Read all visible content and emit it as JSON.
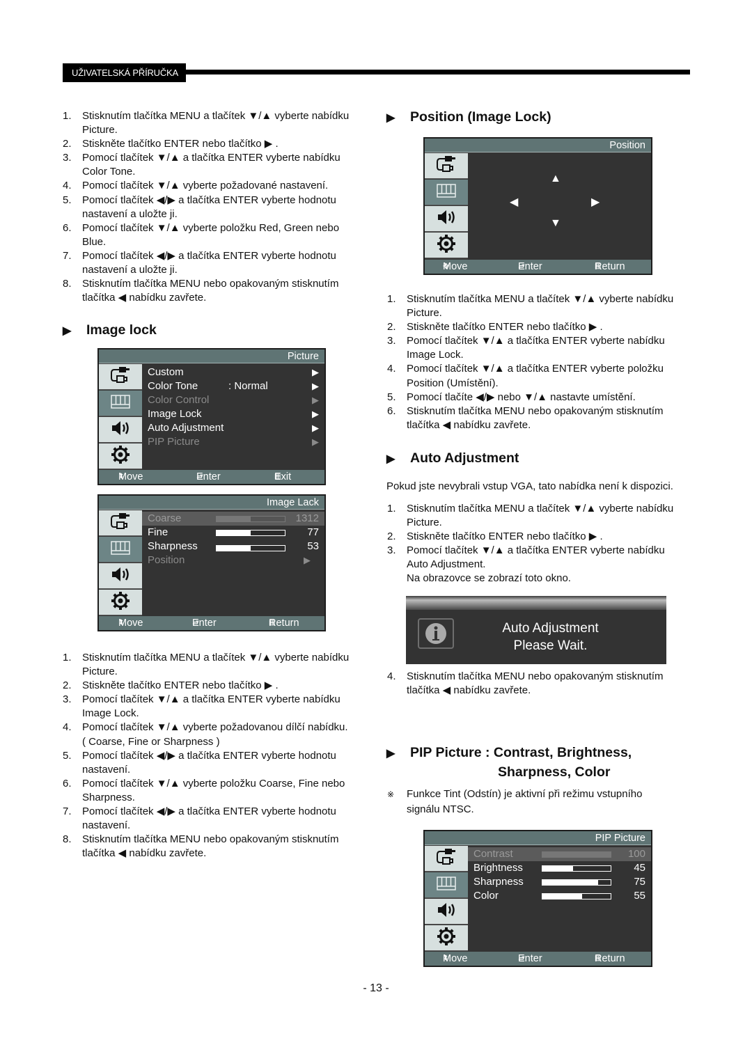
{
  "header": {
    "tag": "UŽIVATELSKÁ PŘÍRUČKA"
  },
  "left": {
    "steps_intro": [
      {
        "n": "1.",
        "lines": [
          "Stisknutím tlačítka MENU a tlačítek ▼/▲ vyberte nabídku",
          "Picture."
        ]
      },
      {
        "n": "2.",
        "lines": [
          "Stiskněte tlačítko ENTER nebo tlačítko ▶ ."
        ]
      },
      {
        "n": "3.",
        "lines": [
          "Pomocí tlačítek ▼/▲ a tlačítka ENTER vyberte nabídku",
          "Color Tone."
        ]
      },
      {
        "n": "4.",
        "lines": [
          "Pomocí tlačítek ▼/▲ vyberte požadované nastavení."
        ]
      },
      {
        "n": "5.",
        "lines": [
          "Pomocí tlačítek ◀/▶ a tlačítka ENTER vyberte hodnotu",
          "nastavení a uložte ji."
        ]
      },
      {
        "n": "6.",
        "lines": [
          "Pomocí tlačítek ▼/▲ vyberte položku Red, Green nebo",
          "Blue."
        ]
      },
      {
        "n": "7.",
        "lines": [
          "Pomocí tlačítek ◀/▶ a tlačítka ENTER vyberte hodnotu",
          "nastavení a uložte ji."
        ]
      },
      {
        "n": "8.",
        "lines": [
          "Stisknutím tlačítka MENU nebo opakovaným stisknutím",
          "tlačítka ◀ nabídku zavřete."
        ]
      }
    ],
    "image_lock_title": "Image lock",
    "picture_menu": {
      "title": "Picture",
      "items": [
        {
          "label": "Custom",
          "value": "",
          "state": "normal"
        },
        {
          "label": "Color Tone",
          "value": ": Normal",
          "state": "normal"
        },
        {
          "label": "Color Control",
          "value": "",
          "state": "dim"
        },
        {
          "label": "Image Lock",
          "value": "",
          "state": "normal"
        },
        {
          "label": "Auto Adjustment",
          "value": "",
          "state": "normal"
        },
        {
          "label": "PIP Picture",
          "value": "",
          "state": "dim"
        }
      ],
      "footer": {
        "move": "Move",
        "enter": "Enter",
        "exit": "Exit"
      }
    },
    "image_lock_menu": {
      "title": "Image Lack",
      "items": [
        {
          "label": "Coarse",
          "value": "1312",
          "fill_pct": 50,
          "state": "highlight"
        },
        {
          "label": "Fine",
          "value": "77",
          "fill_pct": 50,
          "state": "normal"
        },
        {
          "label": "Sharpness",
          "value": "53",
          "fill_pct": 50,
          "state": "normal"
        },
        {
          "label": "Position",
          "value": "",
          "state": "dim"
        }
      ],
      "footer": {
        "move": "Move",
        "enter": "Enter",
        "exit": "Return"
      }
    },
    "steps_image_lock": [
      {
        "n": "1.",
        "lines": [
          "Stisknutím tlačítka MENU a tlačítek ▼/▲ vyberte nabídku",
          "Picture."
        ]
      },
      {
        "n": "2.",
        "lines": [
          "Stiskněte tlačítko ENTER nebo tlačítko ▶ ."
        ]
      },
      {
        "n": "3.",
        "lines": [
          "Pomocí tlačítek ▼/▲ a tlačítka ENTER vyberte nabídku",
          "Image Lock."
        ]
      },
      {
        "n": "4.",
        "lines": [
          "Pomocí tlačítek ▼/▲ vyberte požadovanou dílčí nabídku.",
          "( Coarse, Fine or Sharpness )"
        ]
      },
      {
        "n": "5.",
        "lines": [
          "Pomocí tlačítek ◀/▶ a tlačítka ENTER vyberte hodnotu",
          "nastavení."
        ]
      },
      {
        "n": "6.",
        "lines": [
          "Pomocí tlačítek ▼/▲ vyberte položku Coarse, Fine nebo",
          "Sharpness."
        ]
      },
      {
        "n": "7.",
        "lines": [
          "Pomocí tlačítek ◀/▶ a tlačítka ENTER vyberte hodnotu",
          "nastavení."
        ]
      },
      {
        "n": "8.",
        "lines": [
          "Stisknutím tlačítka MENU nebo opakovaným stisknutím",
          "tlačítka ◀ nabídku zavřete."
        ]
      }
    ]
  },
  "right": {
    "position_title": "Position (Image Lock)",
    "position_menu": {
      "title": "Position",
      "arrows": {
        "up": "▲",
        "down": "▼",
        "left": "◀",
        "right": "▶"
      },
      "footer": {
        "move": "Move",
        "enter": "Enter",
        "exit": "Return"
      }
    },
    "steps_position": [
      {
        "n": "1.",
        "lines": [
          "Stisknutím tlačítka MENU a tlačítek ▼/▲ vyberte nabídku",
          "Picture."
        ]
      },
      {
        "n": "2.",
        "lines": [
          "Stiskněte tlačítko ENTER nebo tlačítko ▶ ."
        ]
      },
      {
        "n": "3.",
        "lines": [
          "Pomocí tlačítek ▼/▲ a tlačítka ENTER vyberte nabídku",
          "Image Lock."
        ]
      },
      {
        "n": "4.",
        "lines": [
          "Pomocí tlačítek ▼/▲ a tlačítka ENTER vyberte položku",
          "Position (Umístění)."
        ]
      },
      {
        "n": "5.",
        "lines": [
          "Pomocí tlačíte ◀/▶ nebo ▼/▲ nastavte umístění."
        ]
      },
      {
        "n": "6.",
        "lines": [
          "Stisknutím tlačítka MENU nebo opakovaným stisknutím",
          "tlačítka ◀ nabídku zavřete."
        ]
      }
    ],
    "auto_adj_title": "Auto Adjustment",
    "auto_adj_note": "Pokud jste nevybrali vstup VGA, tato nabídka není k dispozici.",
    "steps_auto_adj": [
      {
        "n": "1.",
        "lines": [
          "Stisknutím tlačítka MENU a tlačítek ▼/▲ vyberte nabídku",
          "Picture."
        ]
      },
      {
        "n": "2.",
        "lines": [
          "Stiskněte tlačítko ENTER nebo tlačítko ▶ ."
        ]
      },
      {
        "n": "3.",
        "lines": [
          "Pomocí tlačítek ▼/▲ a tlačítka ENTER vyberte nabídku",
          "Auto Adjustment.",
          "Na obrazovce se zobrazí toto okno."
        ]
      }
    ],
    "auto_adj_box": {
      "line1": "Auto Adjustment",
      "line2": "Please Wait."
    },
    "steps_auto_adj_end": [
      {
        "n": "4.",
        "lines": [
          "Stisknutím tlačítka MENU nebo opakovaným stisknutím",
          "tlačítka ◀ nabídku zavřete."
        ]
      }
    ],
    "pip_title_line1": "PIP Picture : Contrast, Brightness,",
    "pip_title_line2": "Sharpness, Color",
    "pip_note_mark": "※",
    "pip_note_lines": [
      "Funkce Tint (Odstín) je aktivní při režimu vstupního",
      "signálu NTSC."
    ],
    "pip_menu": {
      "title": "PIP Picture",
      "items": [
        {
          "label": "Contrast",
          "value": "100",
          "fill_pct": 100,
          "state": "highlight"
        },
        {
          "label": "Brightness",
          "value": "45",
          "fill_pct": 45,
          "state": "normal"
        },
        {
          "label": "Sharpness",
          "value": "75",
          "fill_pct": 82,
          "state": "normal"
        },
        {
          "label": "Color",
          "value": "55",
          "fill_pct": 58,
          "state": "normal"
        }
      ],
      "footer": {
        "move": "Move",
        "enter": "Enter",
        "exit": "Return"
      }
    }
  },
  "footer": {
    "page_number": "- 13 -"
  },
  "colors": {
    "osd_bar": "#5f7474",
    "osd_bg": "#333333",
    "tile": "#d7e0df",
    "tile_selected": "#6d8586"
  }
}
